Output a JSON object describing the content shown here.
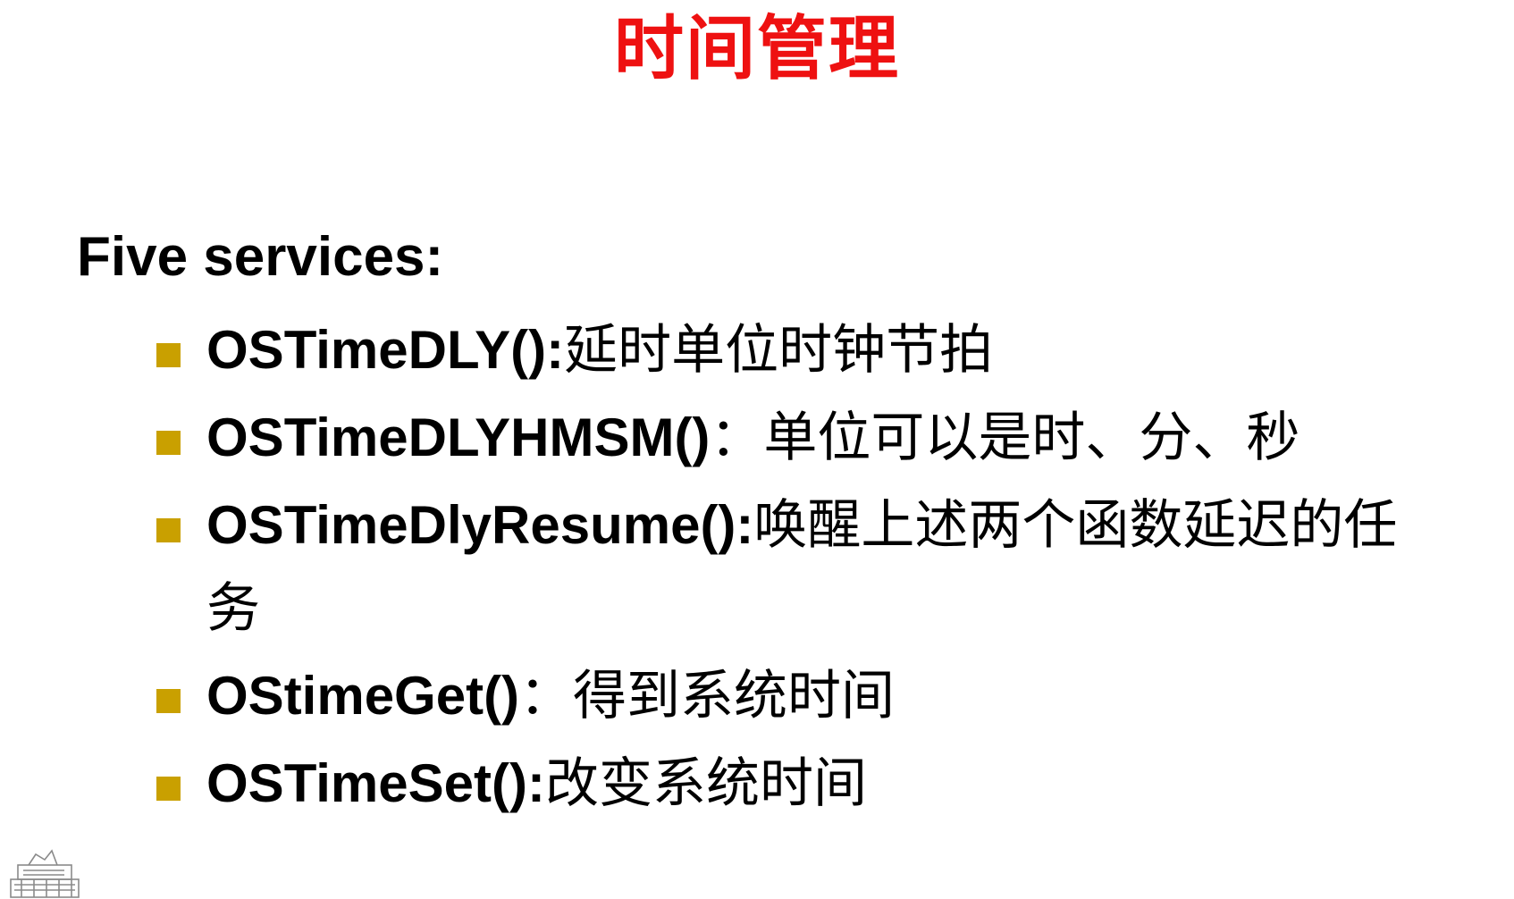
{
  "slide": {
    "title": "时间管理",
    "heading": "Five services:",
    "items": [
      {
        "code": "OSTimeDLY():",
        "desc": "延时单位时钟节拍"
      },
      {
        "code": "OSTimeDLYHMSM()",
        "desc": "：单位可以是时、分、秒"
      },
      {
        "code": "OSTimeDlyResume():",
        "desc": "唤醒上述两个函数延迟的任务"
      },
      {
        "code": "OStimeGet()",
        "desc": "：得到系统时间"
      },
      {
        "code": "OSTimeSet():",
        "desc": "改变系统时间"
      }
    ]
  },
  "colors": {
    "title": "#ee1111",
    "text": "#000000",
    "bullet": "#c9a000",
    "background": "#ffffff",
    "logo": "#8a8a8a"
  },
  "icons": {
    "bullet": "square-bullet-icon",
    "logo": "printer-logo-icon"
  }
}
